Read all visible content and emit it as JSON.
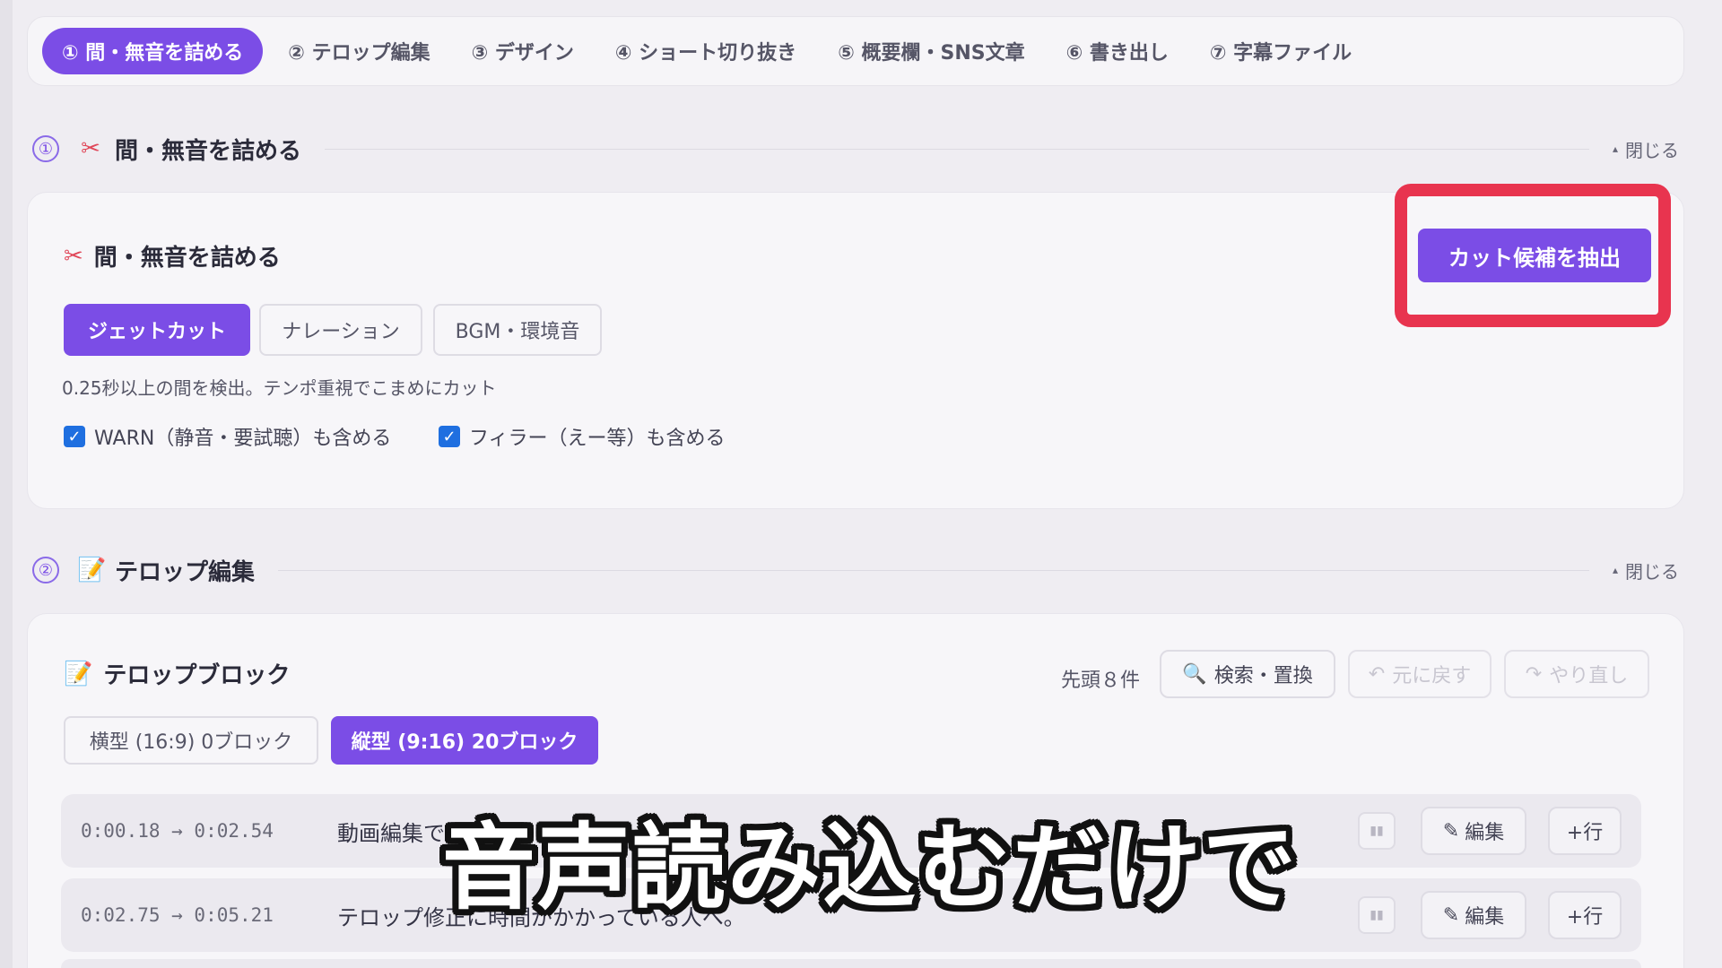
{
  "tabs": [
    {
      "label": "① 間・無音を詰める",
      "active": true
    },
    {
      "label": "② テロップ編集",
      "active": false
    },
    {
      "label": "③ デザイン",
      "active": false
    },
    {
      "label": "④ ショート切り抜き",
      "active": false
    },
    {
      "label": "⑤ 概要欄・SNS文章",
      "active": false
    },
    {
      "label": "⑥ 書き出し",
      "active": false
    },
    {
      "label": "⑦ 字幕ファイル",
      "active": false
    }
  ],
  "section1": {
    "num": "①",
    "icon": "✂",
    "title": "間・無音を詰める",
    "close": "閉じる",
    "card": {
      "icon": "✂",
      "title": "間・無音を詰める",
      "extract_button": "カット候補を抽出",
      "modes": [
        "ジェットカット",
        "ナレーション",
        "BGM・環境音"
      ],
      "description": "0.25秒以上の間を検出。テンポ重視でこまめにカット",
      "checkbox_warn": "WARN（静音・要試聴）も含める",
      "checkbox_filler": "フィラー（えー等）も含める"
    }
  },
  "section2": {
    "num": "②",
    "icon": "📝",
    "title": "テロップ編集",
    "close": "閉じる",
    "card": {
      "icon": "📝",
      "title": "テロップブロック",
      "count_text": "先頭８件",
      "search_button": "検索・置換",
      "undo_button": "元に戻す",
      "redo_button": "やり直し",
      "orientation_tabs": [
        "横型 (16:9) 0ブロック",
        "縦型 (9:16) 20ブロック"
      ],
      "rows": [
        {
          "time": "0:00.18 → 0:02.54",
          "text": "動画編集でカ"
        },
        {
          "time": "0:02.75 → 0:05.21",
          "text": "テロップ修正に時間がかかっている人へ。"
        }
      ],
      "edit_label": "編集",
      "add_row_label": "+行"
    }
  },
  "caption": "音声読み込むだけで"
}
